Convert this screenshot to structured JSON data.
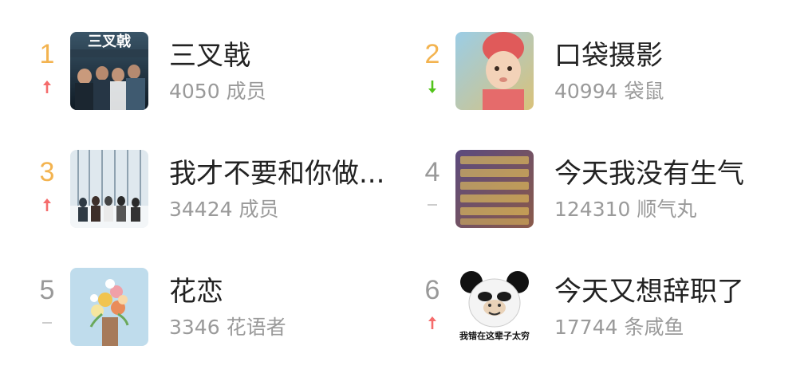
{
  "items": [
    {
      "rank": "1",
      "trend": "up",
      "name": "三叉戟",
      "count": "4050",
      "unit": "成员",
      "cover_caption": "三叉戟",
      "cover_icon": "group-photo"
    },
    {
      "rank": "2",
      "trend": "down",
      "name": "口袋摄影",
      "count": "40994",
      "unit": "袋鼠",
      "cover_icon": "baby-portrait"
    },
    {
      "rank": "3",
      "trend": "up",
      "name": "我才不要和你做...",
      "count": "34424",
      "unit": "成员",
      "cover_icon": "snow-forest-group"
    },
    {
      "rank": "4",
      "trend": "same",
      "name": "今天我没有生气",
      "count": "124310",
      "unit": "顺气丸",
      "cover_icon": "text-meme"
    },
    {
      "rank": "5",
      "trend": "same",
      "name": "花恋",
      "count": "3346",
      "unit": "花语者",
      "cover_icon": "flower-bouquet"
    },
    {
      "rank": "6",
      "trend": "up",
      "name": "今天又想辞职了",
      "count": "17744",
      "unit": "条咸鱼",
      "cover_caption": "我错在这辈子太穷",
      "cover_icon": "panda-meme"
    }
  ],
  "colors": {
    "rank_top": "#f3b34f",
    "rank_other": "#999999",
    "trend_up": "#f56c6c",
    "trend_down": "#52c41a",
    "trend_same": "#cccccc",
    "title": "#222222",
    "meta": "#9a9a9a"
  }
}
